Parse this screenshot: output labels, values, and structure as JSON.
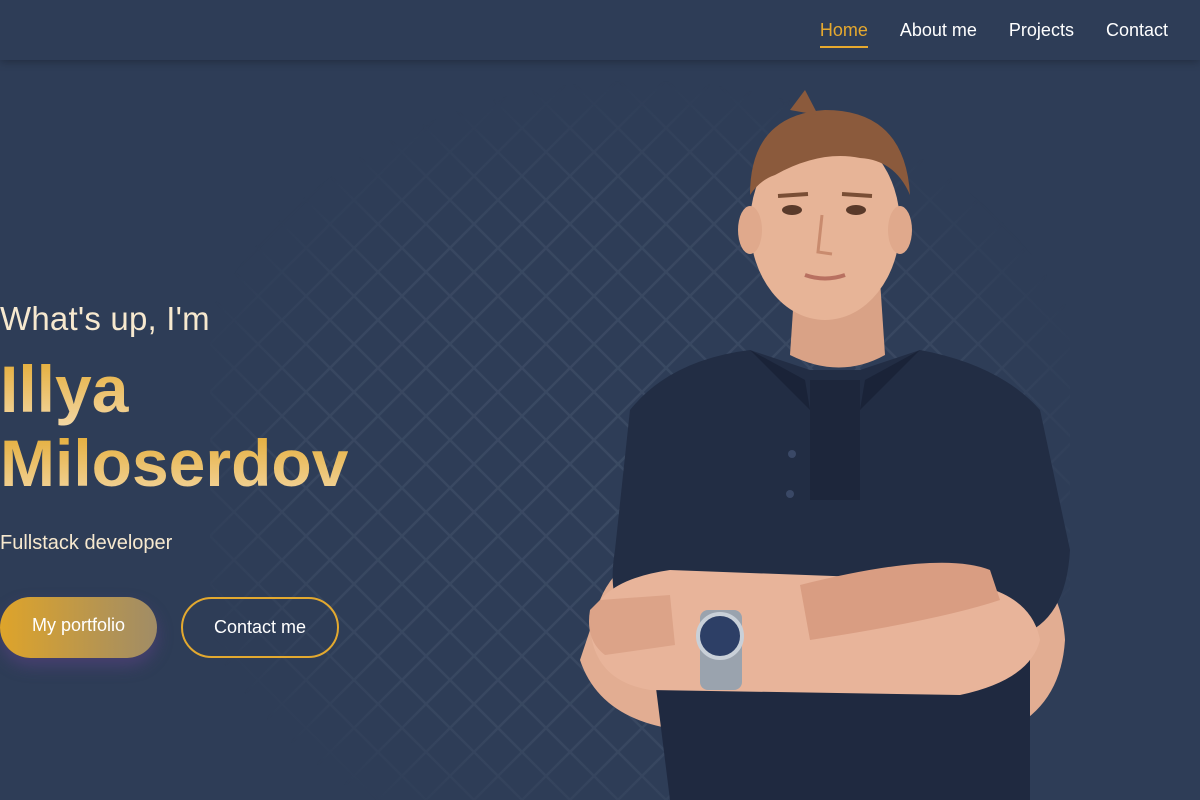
{
  "nav": {
    "items": [
      {
        "label": "Home",
        "active": true
      },
      {
        "label": "About me",
        "active": false
      },
      {
        "label": "Projects",
        "active": false
      },
      {
        "label": "Contact",
        "active": false
      }
    ]
  },
  "hero": {
    "greeting": "What's up, I'm",
    "first_name": "Illya",
    "last_name": "Miloserdov",
    "role": "Fullstack developer",
    "primary_button": "My portfolio",
    "secondary_button": "Contact me"
  },
  "colors": {
    "background": "#2e3d57",
    "accent": "#e6a92e",
    "text_light": "#f7e9cf"
  }
}
